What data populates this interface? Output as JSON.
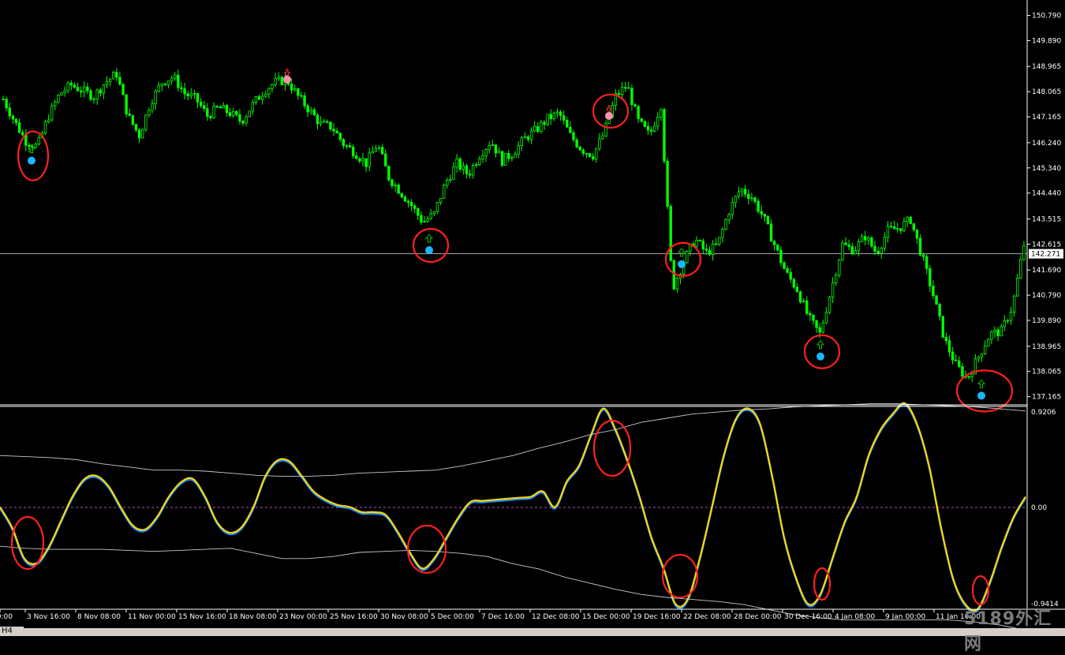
{
  "chart_data": [
    {
      "type": "candlestick",
      "panel": "price",
      "y_tick_labels": [
        "150.790",
        "149.890",
        "148.965",
        "148.065",
        "147.165",
        "146.240",
        "145.340",
        "144.440",
        "143.515",
        "142.615",
        "141.690",
        "140.790",
        "139.890",
        "138.965",
        "138.065",
        "137.165"
      ],
      "current_price_label": "142.271",
      "close_path": [
        147.8,
        147.0,
        146.3,
        146.1,
        147.2,
        148.0,
        148.3,
        148.1,
        147.9,
        148.4,
        148.7,
        147.2,
        146.5,
        147.7,
        148.4,
        148.6,
        148.0,
        147.8,
        147.2,
        147.5,
        147.3,
        147.0,
        147.6,
        148.1,
        148.4,
        148.5,
        147.9,
        147.4,
        146.9,
        146.8,
        146.2,
        145.9,
        145.5,
        146.2,
        145.0,
        144.5,
        144.0,
        143.4,
        143.7,
        144.8,
        145.5,
        145.1,
        145.8,
        146.3,
        145.6,
        145.9,
        146.4,
        146.7,
        147.1,
        147.3,
        146.5,
        146.0,
        145.8,
        146.6,
        147.9,
        148.3,
        147.0,
        146.5,
        147.6,
        141.0,
        142.0,
        142.8,
        142.3,
        142.6,
        143.8,
        144.6,
        144.3,
        143.6,
        142.6,
        141.6,
        141.0,
        140.0,
        139.4,
        141.0,
        142.6,
        142.4,
        142.9,
        142.3,
        143.1,
        143.2,
        143.5,
        142.2,
        140.8,
        139.2,
        138.3,
        137.8,
        138.6,
        139.4,
        139.5,
        140.4,
        142.6
      ],
      "signals": [
        {
          "type": "buy",
          "value": 145.6
        },
        {
          "type": "sell",
          "value": 148.5
        },
        {
          "type": "buy",
          "value": 142.4
        },
        {
          "type": "sell",
          "value": 147.2
        },
        {
          "type": "buy",
          "value": 141.9
        },
        {
          "type": "buy",
          "value": 138.6
        },
        {
          "type": "buy",
          "value": 137.2
        }
      ],
      "colors": {
        "candles": "#00ff00",
        "buy_dot": "#19b7ff",
        "sell_dot": "#ff8fb0",
        "circle": "#ff2020",
        "price_line": "#c0c0c0"
      }
    },
    {
      "type": "line",
      "panel": "oscillator",
      "y_tick_labels": [
        "0.9206",
        "0.00",
        "-0.9414"
      ],
      "ylim": [
        -0.9414,
        0.9206
      ],
      "series": [
        {
          "values": [
            0.0,
            -0.2,
            -0.5,
            -0.55,
            -0.4,
            -0.15,
            0.1,
            0.27,
            0.3,
            0.2,
            0.0,
            -0.18,
            -0.22,
            -0.1,
            0.1,
            0.24,
            0.27,
            0.1,
            -0.15,
            -0.25,
            -0.2,
            0.0,
            0.3,
            0.45,
            0.44,
            0.3,
            0.15,
            0.07,
            0.02,
            0.0,
            -0.05,
            -0.05,
            -0.08,
            -0.25,
            -0.45,
            -0.6,
            -0.5,
            -0.3,
            -0.1,
            0.05,
            0.06,
            0.07,
            0.08,
            0.09,
            0.1,
            0.15,
            0.0,
            0.25,
            0.4,
            0.7,
            0.95,
            0.75,
            0.45,
            0.1,
            -0.3,
            -0.6,
            -0.95,
            -0.9,
            -0.5,
            0.0,
            0.5,
            0.85,
            0.95,
            0.8,
            0.3,
            -0.3,
            -0.7,
            -0.95,
            -0.85,
            -0.5,
            -0.15,
            0.1,
            0.5,
            0.75,
            0.9,
            1.0,
            0.8,
            0.4,
            -0.2,
            -0.7,
            -0.95,
            -1.0,
            -0.75,
            -0.4,
            -0.1,
            0.1
          ],
          "color": "#1e90ff"
        },
        {
          "values": [
            0.0,
            -0.2,
            -0.5,
            -0.55,
            -0.4,
            -0.15,
            0.1,
            0.27,
            0.3,
            0.2,
            0.0,
            -0.18,
            -0.22,
            -0.1,
            0.1,
            0.24,
            0.27,
            0.1,
            -0.15,
            -0.25,
            -0.2,
            0.0,
            0.3,
            0.45,
            0.44,
            0.3,
            0.15,
            0.07,
            0.02,
            0.0,
            -0.05,
            -0.05,
            -0.08,
            -0.25,
            -0.45,
            -0.6,
            -0.5,
            -0.3,
            -0.1,
            0.05,
            0.06,
            0.07,
            0.08,
            0.09,
            0.1,
            0.15,
            0.0,
            0.25,
            0.4,
            0.7,
            0.95,
            0.75,
            0.45,
            0.1,
            -0.3,
            -0.6,
            -0.95,
            -0.9,
            -0.5,
            0.0,
            0.5,
            0.85,
            0.95,
            0.8,
            0.3,
            -0.3,
            -0.7,
            -0.95,
            -0.85,
            -0.5,
            -0.15,
            0.1,
            0.5,
            0.75,
            0.9,
            1.0,
            0.8,
            0.4,
            -0.2,
            -0.7,
            -0.95,
            -1.0,
            -0.75,
            -0.4,
            -0.1,
            0.1
          ],
          "color": "#ffd700"
        },
        {
          "values": [
            0.5,
            0.49,
            0.48,
            0.46,
            0.42,
            0.39,
            0.36,
            0.36,
            0.35,
            0.33,
            0.31,
            0.3,
            0.3,
            0.31,
            0.33,
            0.34,
            0.35,
            0.36,
            0.4,
            0.45,
            0.5,
            0.57,
            0.63,
            0.7,
            0.75,
            0.82,
            0.86,
            0.9,
            0.92,
            0.94,
            0.95,
            0.97,
            0.98,
            0.99,
            1.0,
            1.0,
            0.99,
            0.98,
            0.97,
            0.95,
            0.93
          ],
          "color": "#c8c8c8"
        },
        {
          "values": [
            -0.38,
            -0.4,
            -0.41,
            -0.41,
            -0.41,
            -0.42,
            -0.43,
            -0.42,
            -0.41,
            -0.4,
            -0.45,
            -0.5,
            -0.5,
            -0.48,
            -0.44,
            -0.43,
            -0.42,
            -0.43,
            -0.45,
            -0.48,
            -0.55,
            -0.6,
            -0.68,
            -0.74,
            -0.8,
            -0.85,
            -0.88,
            -0.9,
            -0.92,
            -0.95,
            -1.0,
            -1.05,
            -1.08,
            -1.1,
            -1.1,
            -1.1,
            -1.1,
            -1.1,
            -1.12,
            -1.15,
            -1.2
          ],
          "color": "#c8c8c8"
        }
      ],
      "zero_line_color": "#ff66ff"
    }
  ],
  "x_tick_labels": [
    "00:00",
    "3 Nov 16:00",
    "8 Nov 08:00",
    "11 Nov 00:00",
    "15 Nov 16:00",
    "18 Nov 08:00",
    "23 Nov 00:00",
    "25 Nov 16:00",
    "30 Nov 08:00",
    "5 Dec 00:00",
    "7 Dec 16:00",
    "12 Dec 08:00",
    "15 Dec 00:00",
    "19 Dec 16:00",
    "22 Dec 08:00",
    "28 Dec 00:00",
    "30 Dec 16:00",
    "4 Jan 08:00",
    "9 Jan 00:00",
    "11 Jan 16:00"
  ],
  "timeframe_label": "H4",
  "watermark": "5189外汇网"
}
